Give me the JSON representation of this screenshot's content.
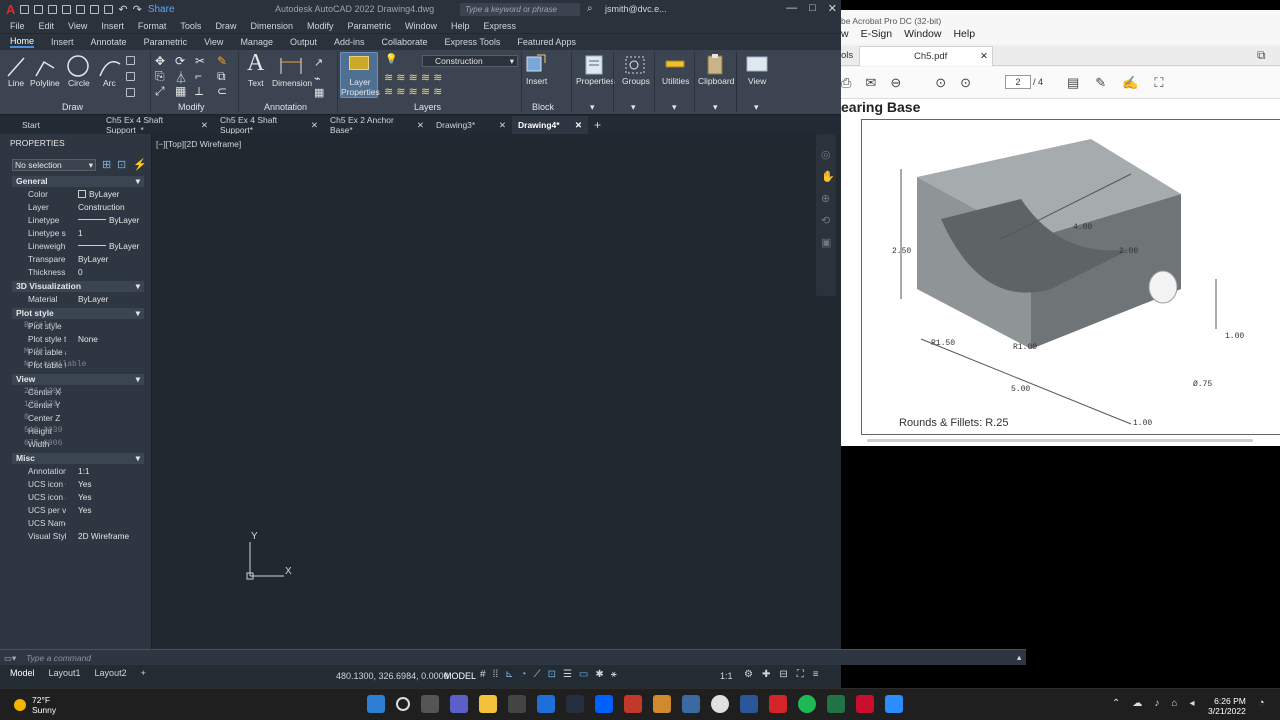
{
  "autocad": {
    "title": "Autodesk AutoCAD 2022    Drawing4.dwg",
    "share": "Share",
    "search_placeholder": "Type a keyword or phrase",
    "user": "jsmith@dvc.e...",
    "menu": [
      "File",
      "Edit",
      "View",
      "Insert",
      "Format",
      "Tools",
      "Draw",
      "Dimension",
      "Modify",
      "Parametric",
      "Window",
      "Help",
      "Express"
    ],
    "ribbon_tabs": [
      "Home",
      "Insert",
      "Annotate",
      "Parametric",
      "View",
      "Manage",
      "Output",
      "Add-ins",
      "Collaborate",
      "Express Tools",
      "Featured Apps"
    ],
    "tools": {
      "line": "Line",
      "polyline": "Polyline",
      "circle": "Circle",
      "arc": "Arc",
      "text": "Text",
      "dimension": "Dimension",
      "layer_properties_1": "Layer",
      "layer_properties_2": "Properties",
      "insert": "Insert",
      "properties": "Properties",
      "groups": "Groups",
      "utilities": "Utilities",
      "clipboard": "Clipboard",
      "view": "View"
    },
    "layer_current": "Construction",
    "panels": {
      "draw": "Draw",
      "modify": "Modify",
      "annotation": "Annotation",
      "layers": "Layers",
      "block": "Block"
    },
    "file_tabs": [
      {
        "label": "Start",
        "close": ""
      },
      {
        "label": "Ch5 Ex 4 Shaft Support_*",
        "close": "✕"
      },
      {
        "label": "Ch5 Ex 4 Shaft Support*",
        "close": "✕"
      },
      {
        "label": "Ch5 Ex 2 Anchor Base*",
        "close": "✕"
      },
      {
        "label": "Drawing3*",
        "close": "✕"
      },
      {
        "label": "Drawing4*",
        "close": "✕"
      }
    ],
    "properties_panel": {
      "header": "PROPERTIES",
      "selection": "No selection",
      "general": "General",
      "color_k": "Color",
      "color_v": "ByLayer",
      "layer_k": "Layer",
      "layer_v": "Construction",
      "linetype_k": "Linetype",
      "linetype_v": "ByLayer",
      "ltscale_k": "Linetype sc...",
      "ltscale_v": "1",
      "lineweight_k": "Lineweight",
      "lineweight_v": "ByLayer",
      "transp_k": "Transparen...",
      "transp_v": "ByLayer",
      "thick_k": "Thickness",
      "thick_v": "0",
      "viz": "3D Visualization",
      "material_k": "Material",
      "material_v": "ByLayer",
      "plot": "Plot style",
      "ps_k": "Plot style",
      "ps_v": "ByColor",
      "pst_k": "Plot style t...",
      "pst_v": "None",
      "pta_k": "Plot table a...",
      "pta_v": "Model",
      "ptt_k": "Plot table t...",
      "ptt_v": "Not available",
      "view": "View",
      "cx_k": "Center X",
      "cx_v": "236.4391",
      "cy_k": "Center Y",
      "cy_v": "170.473",
      "cz_k": "Center Z",
      "cz_v": "0",
      "h_k": "Height",
      "h_v": "510.2939",
      "w_k": "Width",
      "w_v": "675.6906",
      "misc": "Misc",
      "ann_k": "Annotation...",
      "ann_v": "1:1",
      "ucson_k": "UCS icon On",
      "ucson_v": "Yes",
      "ucsa_k": "UCS icon a...",
      "ucsa_v": "Yes",
      "ucsp_k": "UCS per vi...",
      "ucsp_v": "Yes",
      "ucsn_k": "UCS Name",
      "ucsn_v": "",
      "vs_k": "Visual Style",
      "vs_v": "2D Wireframe"
    },
    "viewport_label": "[−][Top][2D Wireframe]",
    "command_placeholder": "Type a command",
    "layout_tabs": [
      "Model",
      "Layout1",
      "Layout2"
    ],
    "coordinates": "480.1300, 326.6984, 0.0000",
    "model_label": "MODEL",
    "scale": "1:1",
    "ucs_x": "X",
    "ucs_y": "Y"
  },
  "acrobat": {
    "title": "be Acrobat Pro DC (32-bit)",
    "menu": [
      "w",
      "E-Sign",
      "Window",
      "Help"
    ],
    "tab_tools": "ols",
    "tab_file": "Ch5.pdf",
    "page_current": "2",
    "page_total": "/ 4",
    "doc_heading": "earing Base",
    "dims": {
      "d250": "2.50",
      "d400": "4.00",
      "d200": "2.00",
      "r150": "R1.50",
      "r100": "R1.00",
      "d100a": "1.00",
      "d500": "5.00",
      "d075": "Ø.75",
      "d100b": "1.00"
    },
    "fillet_note": "Rounds & Fillets: R.25"
  },
  "taskbar": {
    "temp": "72°F",
    "weather": "Sunny",
    "time": "6:26 PM",
    "date": "3/21/2022"
  },
  "colors": {
    "accent": "#4a90d9",
    "autocad_red": "#e4262f",
    "acrobat_red": "#d3242a"
  }
}
